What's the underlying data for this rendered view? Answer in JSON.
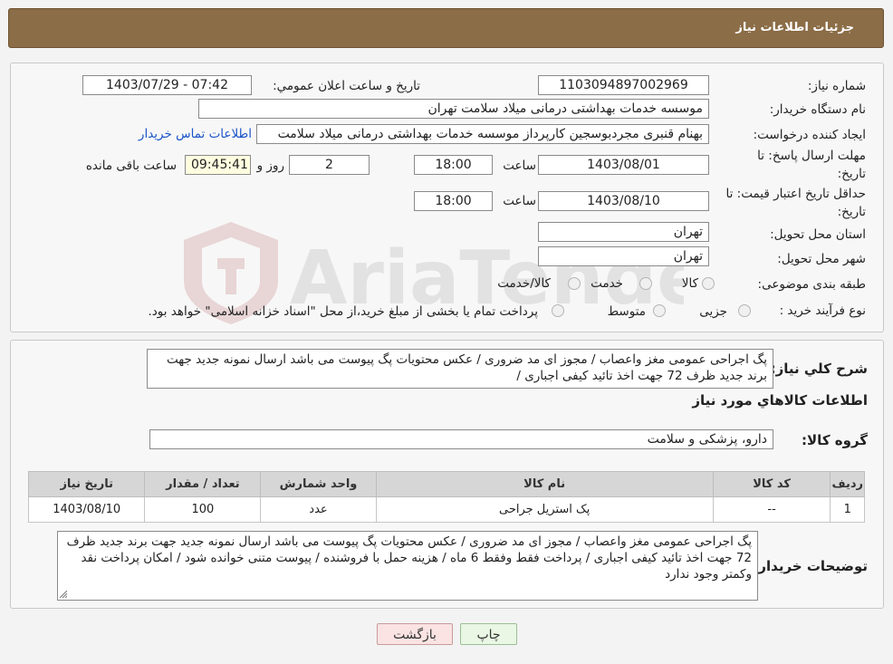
{
  "header": {
    "title": "جزئیات اطلاعات نیاز"
  },
  "watermark": {
    "text": "AriaTender.neT"
  },
  "form": {
    "need_number": {
      "label": "شماره نیاز:",
      "value": "1103094897002969"
    },
    "announce_datetime": {
      "label": "تاریخ و ساعت اعلان عمومي:",
      "value": "1403/07/29 - 07:42"
    },
    "buyer_org": {
      "label": "نام دستگاه خریدار:",
      "value": "موسسه خدمات بهداشتی درمانی میلاد سلامت تهران"
    },
    "requester": {
      "label": "ایجاد کننده درخواست:",
      "value": "بهنام قنبری مجردبوسجین کارپرداز موسسه خدمات بهداشتی درمانی میلاد سلامت",
      "contact_link": "اطلاعات تماس خریدار"
    },
    "deadline": {
      "label_line1": "مهلت ارسال پاسخ: تا",
      "label_line2": "تاریخ:",
      "date": "1403/08/01",
      "time_label": "ساعت",
      "time": "18:00",
      "days": "2",
      "days_label": "روز و",
      "remaining": "09:45:41",
      "remaining_label": "ساعت باقی مانده"
    },
    "price_validity": {
      "label_line1": "حداقل تاریخ اعتبار قیمت: تا",
      "label_line2": "تاریخ:",
      "date": "1403/08/10",
      "time_label": "ساعت",
      "time": "18:00"
    },
    "province": {
      "label": "استان محل تحویل:",
      "value": "تهران"
    },
    "city": {
      "label": "شهر محل تحویل:",
      "value": "تهران"
    },
    "category": {
      "label": "طبقه بندی موضوعی:",
      "options": [
        "کالا",
        "خدمت",
        "کالا/خدمت"
      ]
    },
    "purchase_process": {
      "label": "نوع فرآیند خرید :",
      "options": [
        "جزیی",
        "متوسط"
      ],
      "note": "پرداخت تمام یا بخشی از مبلغ خرید،از محل \"اسناد خزانه اسلامی\" خواهد بود."
    }
  },
  "summary": {
    "label": "شرح کلي نياز:",
    "text": "پگ اجراحی عمومی مغز واعصاب / مجوز ای مد ضروری / عکس محتویات پگ پیوست می باشد ارسال نمونه جدید جهت برند جدید ظرف 72 جهت اخذ تائید کیفی اجباری /"
  },
  "goods_info": {
    "title": "اطلاعات کالاهاي مورد نياز",
    "group_label": "گروه کالا:",
    "group_value": "دارو، پزشکی و سلامت",
    "table": {
      "columns": [
        "ردیف",
        "کد کالا",
        "نام کالا",
        "واحد شمارش",
        "تعداد / مقدار",
        "تاریخ نیاز"
      ],
      "rows": [
        [
          "1",
          "--",
          "پک استریل جراحی",
          "عدد",
          "100",
          "1403/08/10"
        ]
      ]
    },
    "buyer_notes_label": "توضیحات خریدار:",
    "buyer_notes": "پگ اجراحی عمومی مغز واعصاب / مجوز ای مد ضروری / عکس محتویات پگ پیوست می باشد ارسال نمونه جدید جهت برند جدید ظرف 72 جهت اخذ تائید کیفی اجباری / پرداخت فقط وفقط 6  ماه / هزینه حمل با فروشنده / پیوست  متنی خوانده شود / امکان پرداخت نقد وکمتر وجود ندارد"
  },
  "buttons": {
    "print": "چاپ",
    "back": "بازگشت"
  },
  "colors": {
    "header_bg": "#8b6d47",
    "link": "#1a55c9",
    "print_bg": "#e9f7e4",
    "back_bg": "#fbe3e3"
  }
}
